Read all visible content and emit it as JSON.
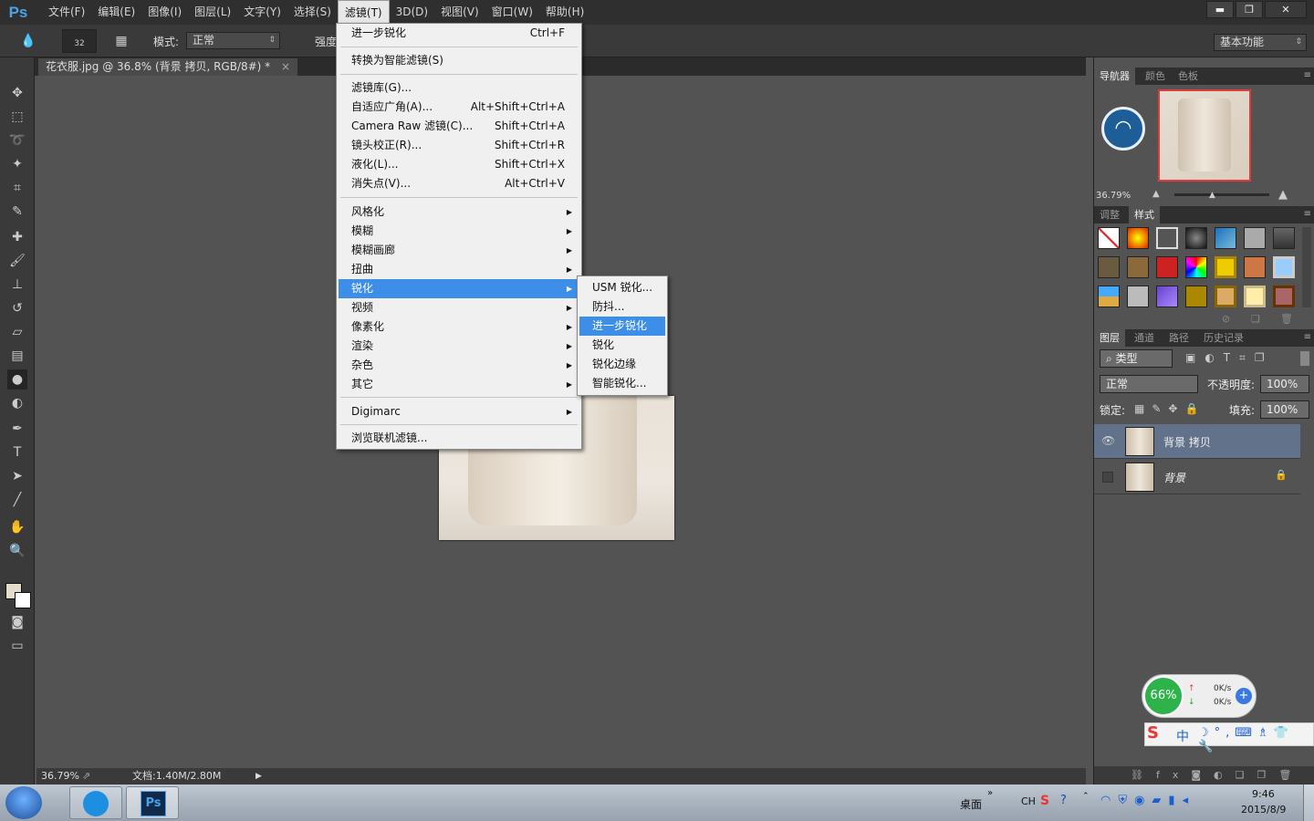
{
  "app": {
    "logo": "Ps"
  },
  "menubar": {
    "items": [
      "文件(F)",
      "编辑(E)",
      "图像(I)",
      "图层(L)",
      "文字(Y)",
      "选择(S)",
      "滤镜(T)",
      "3D(D)",
      "视图(V)",
      "窗口(W)",
      "帮助(H)"
    ],
    "active_index": 6
  },
  "window_buttons": {
    "minimize": "▬",
    "restore": "❐",
    "close": "✕"
  },
  "options": {
    "brush_size": "32",
    "mode_label": "模式:",
    "mode_value": "正常",
    "strength_label": "强度",
    "workspace": "基本功能"
  },
  "document": {
    "tab_title": "花衣服.jpg @ 36.8% (背景 拷贝, RGB/8#) *",
    "zoom": "36.79%",
    "doc_info": "文档:1.40M/2.80M"
  },
  "filter_menu": {
    "items": [
      {
        "label": "进一步锐化",
        "shortcut": "Ctrl+F"
      },
      {
        "label": "转换为智能滤镜(S)",
        "shortcut": ""
      },
      {
        "label": "滤镜库(G)...",
        "shortcut": ""
      },
      {
        "label": "自适应广角(A)...",
        "shortcut": "Alt+Shift+Ctrl+A"
      },
      {
        "label": "Camera Raw 滤镜(C)...",
        "shortcut": "Shift+Ctrl+A"
      },
      {
        "label": "镜头校正(R)...",
        "shortcut": "Shift+Ctrl+R"
      },
      {
        "label": "液化(L)...",
        "shortcut": "Shift+Ctrl+X"
      },
      {
        "label": "消失点(V)...",
        "shortcut": "Alt+Ctrl+V"
      },
      {
        "label": "风格化",
        "shortcut": ""
      },
      {
        "label": "模糊",
        "shortcut": ""
      },
      {
        "label": "模糊画廊",
        "shortcut": ""
      },
      {
        "label": "扭曲",
        "shortcut": ""
      },
      {
        "label": "锐化",
        "shortcut": ""
      },
      {
        "label": "视频",
        "shortcut": ""
      },
      {
        "label": "像素化",
        "shortcut": ""
      },
      {
        "label": "渲染",
        "shortcut": ""
      },
      {
        "label": "杂色",
        "shortcut": ""
      },
      {
        "label": "其它",
        "shortcut": ""
      },
      {
        "label": "Digimarc",
        "shortcut": ""
      },
      {
        "label": "浏览联机滤镜...",
        "shortcut": ""
      }
    ]
  },
  "sharpen_submenu": {
    "items": [
      "USM 锐化...",
      "防抖...",
      "进一步锐化",
      "锐化",
      "锐化边缘",
      "智能锐化..."
    ]
  },
  "panels": {
    "navigator_tabs": [
      "导航器",
      "颜色",
      "色板"
    ],
    "navigator_zoom": "36.79%",
    "styles_tabs": [
      "调整",
      "样式"
    ],
    "layers_tabs": [
      "图层",
      "通道",
      "路径",
      "历史记录"
    ],
    "filter_kind": "类型",
    "blend_mode": "正常",
    "opacity_label": "不透明度:",
    "opacity_value": "100%",
    "lock_label": "锁定:",
    "fill_label": "填充:",
    "fill_value": "100%",
    "layers": [
      {
        "name": "背景 拷贝",
        "selected": true
      },
      {
        "name": "背景",
        "selected": false
      }
    ]
  },
  "widgets": {
    "speed_percent": "66%",
    "upload": "0K/s",
    "download": "0K/s",
    "ime": "中"
  },
  "taskbar": {
    "desktop_label": "桌面",
    "lang": "CH",
    "time": "9:46",
    "date": "2015/8/9"
  },
  "colors": {
    "menu_highlight": "#3d8ee8",
    "layer_selected": "#62728a",
    "nav_frame": "#e23b3b"
  }
}
